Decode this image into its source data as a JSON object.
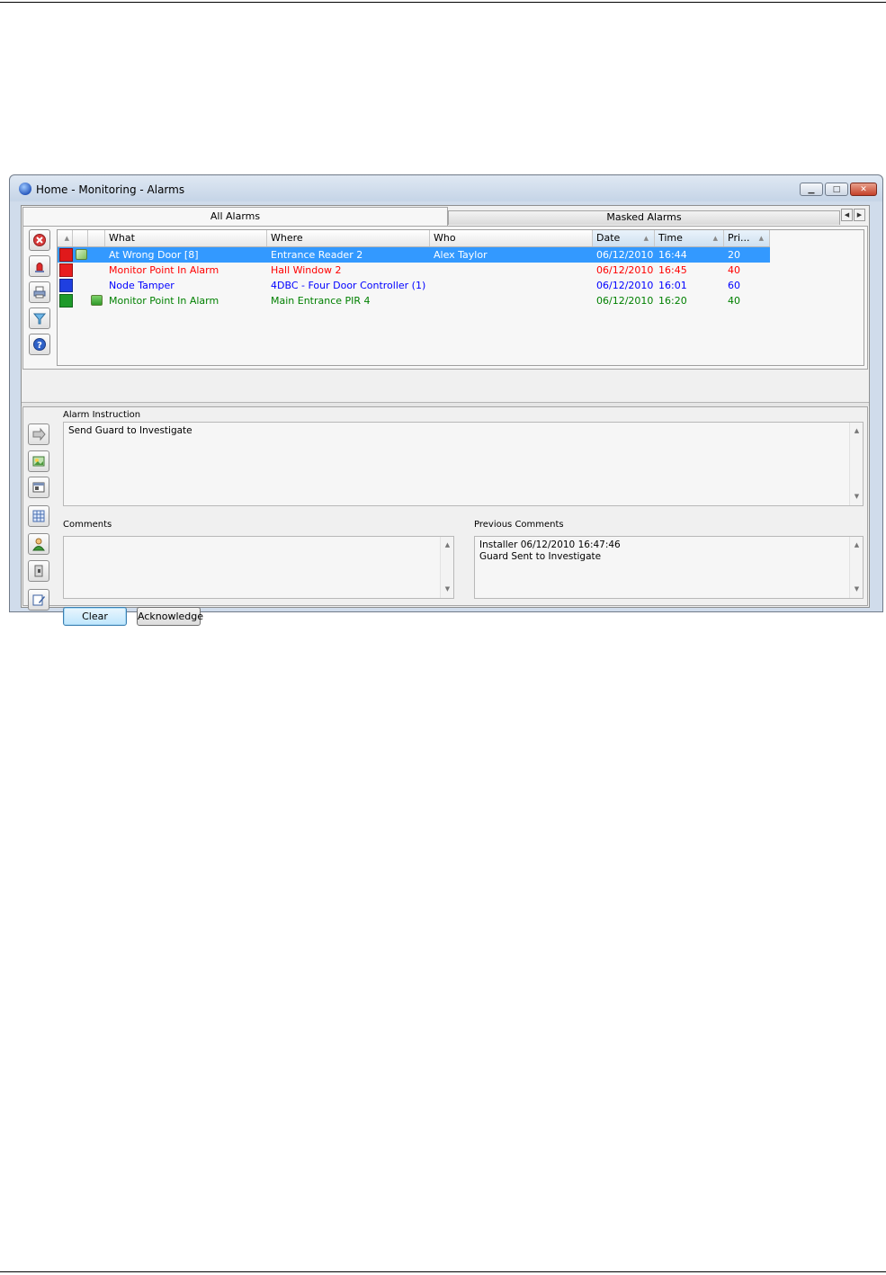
{
  "window": {
    "title": "Home - Monitoring - Alarms"
  },
  "tabs": {
    "active": "All Alarms",
    "inactive": "Masked Alarms"
  },
  "toolbar_top": [
    "close-alarm-icon",
    "alarm-siren-icon",
    "print-icon",
    "filter-icon",
    "help-icon"
  ],
  "grid": {
    "columns": {
      "what": "What",
      "where": "Where",
      "who": "Who",
      "date": "Date",
      "time": "Time",
      "priority": "Pri..."
    },
    "rows": [
      {
        "what": "At Wrong Door [8]",
        "where": "Entrance Reader 2",
        "who": "Alex Taylor",
        "date": "06/12/2010",
        "time": "16:44",
        "priority": "20",
        "color": "#ff0000",
        "square": "#e0191b",
        "icon": "door-reader-icon",
        "selected": true
      },
      {
        "what": "Monitor Point In Alarm",
        "where": "Hall Window 2",
        "who": "",
        "date": "06/12/2010",
        "time": "16:45",
        "priority": "40",
        "color": "#ff0000",
        "square": "#e81e1e",
        "icon": "",
        "selected": false
      },
      {
        "what": "Node Tamper",
        "where": "4DBC - Four Door Controller (1)",
        "who": "",
        "date": "06/12/2010",
        "time": "16:01",
        "priority": "60",
        "color": "#0000ff",
        "square": "#1f3fe0",
        "icon": "",
        "selected": false
      },
      {
        "what": "Monitor Point In Alarm",
        "where": "Main Entrance PIR 4",
        "who": "",
        "date": "06/12/2010",
        "time": "16:20",
        "priority": "40",
        "color": "#008000",
        "square": "#1e9a2a",
        "icon": "monitor-point-icon",
        "selected": false
      }
    ]
  },
  "instruction": {
    "label": "Alarm Instruction",
    "text": "Send Guard to Investigate"
  },
  "comments": {
    "label": "Comments",
    "value": ""
  },
  "previous_comments": {
    "label": "Previous Comments",
    "line1": "Installer 06/12/2010 16:47:46",
    "line2": "Guard Sent to Investigate"
  },
  "buttons": {
    "clear": "Clear",
    "acknowledge": "Acknowledge"
  }
}
